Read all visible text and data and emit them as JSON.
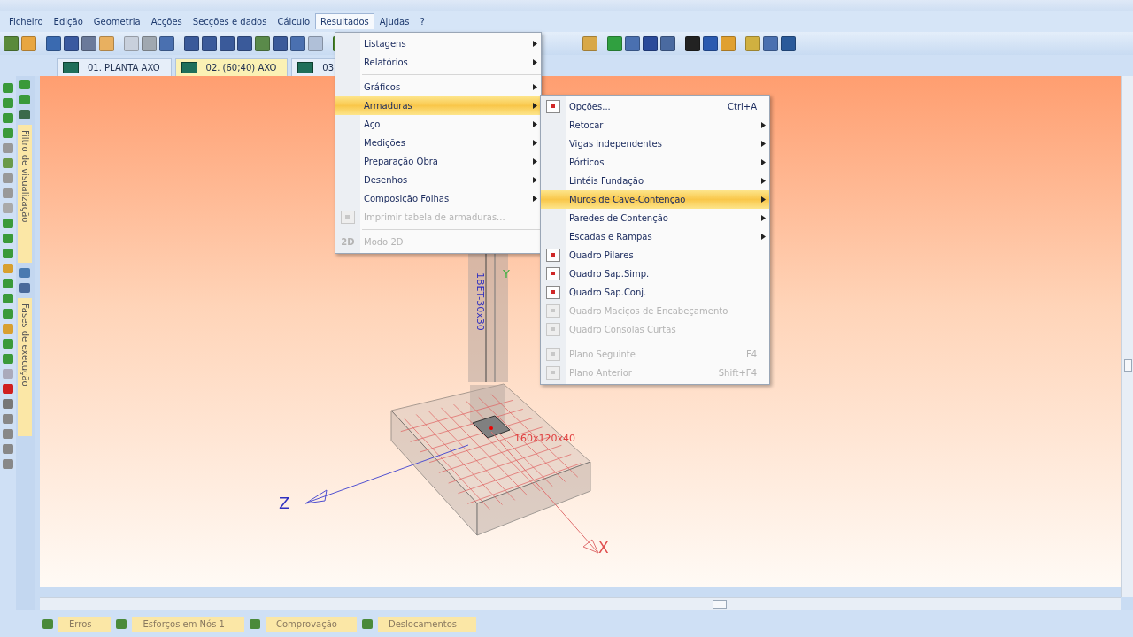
{
  "menu_bar": [
    {
      "label": "Ficheiro",
      "selected": false
    },
    {
      "label": "Edição",
      "selected": false
    },
    {
      "label": "Geometria",
      "selected": false
    },
    {
      "label": "Acções",
      "selected": false
    },
    {
      "label": "Secções e dados",
      "selected": false
    },
    {
      "label": "Cálculo",
      "selected": false
    },
    {
      "label": "Resultados",
      "selected": true
    },
    {
      "label": "Ajudas",
      "selected": false
    },
    {
      "label": "?",
      "selected": false
    }
  ],
  "view_tabs": [
    {
      "label": "01. PLANTA   AXO",
      "selected": false
    },
    {
      "label": "02.  (60;40)  AXO",
      "selected": true
    },
    {
      "label": "03.",
      "selected": false
    }
  ],
  "side_panels": [
    {
      "label": "Filtro de visualização"
    },
    {
      "label": "Fases de execução"
    }
  ],
  "menu": [
    {
      "kind": "item",
      "label": "Listagens",
      "selected": false,
      "disabled": false,
      "submenu": true
    },
    {
      "kind": "item",
      "label": "Relatórios",
      "selected": false,
      "disabled": false,
      "submenu": true
    },
    {
      "kind": "separator"
    },
    {
      "kind": "item",
      "label": "Gráficos",
      "selected": false,
      "disabled": false,
      "submenu": true
    },
    {
      "kind": "item",
      "label": "Armaduras",
      "selected": true,
      "disabled": false,
      "submenu": true
    },
    {
      "kind": "item",
      "label": "Aço",
      "selected": false,
      "disabled": false,
      "submenu": true
    },
    {
      "kind": "item",
      "label": "Medições",
      "selected": false,
      "disabled": false,
      "submenu": true
    },
    {
      "kind": "item",
      "label": "Preparação Obra",
      "selected": false,
      "disabled": false,
      "submenu": true
    },
    {
      "kind": "item",
      "label": "Desenhos",
      "selected": false,
      "disabled": false,
      "submenu": true
    },
    {
      "kind": "item",
      "label": "Composição Folhas",
      "selected": false,
      "disabled": false,
      "submenu": true
    },
    {
      "kind": "item",
      "label": "Imprimir tabela de armaduras...",
      "selected": false,
      "disabled": true,
      "submenu": false,
      "icon": true
    },
    {
      "kind": "separator"
    },
    {
      "kind": "item",
      "label": "Modo 2D",
      "selected": false,
      "disabled": true,
      "submenu": false,
      "icon_text": "2D"
    }
  ],
  "submenu": [
    {
      "kind": "item",
      "label": "Opções...",
      "selected": false,
      "disabled": false,
      "submenu": false,
      "shortcut": "Ctrl+A",
      "icon": true
    },
    {
      "kind": "item",
      "label": "Retocar",
      "selected": false,
      "disabled": false,
      "submenu": true
    },
    {
      "kind": "item",
      "label": "Vigas independentes",
      "selected": false,
      "disabled": false,
      "submenu": true
    },
    {
      "kind": "item",
      "label": "Pórticos",
      "selected": false,
      "disabled": false,
      "submenu": true
    },
    {
      "kind": "item",
      "label": "Lintéis Fundação",
      "selected": false,
      "disabled": false,
      "submenu": true
    },
    {
      "kind": "item",
      "label": "Muros de Cave-Contenção",
      "selected": true,
      "disabled": false,
      "submenu": true
    },
    {
      "kind": "item",
      "label": "Paredes de Contenção",
      "selected": false,
      "disabled": false,
      "submenu": true
    },
    {
      "kind": "item",
      "label": "Escadas e Rampas",
      "selected": false,
      "disabled": false,
      "submenu": true
    },
    {
      "kind": "item",
      "label": "Quadro Pilares",
      "selected": false,
      "disabled": false,
      "submenu": false,
      "icon": true
    },
    {
      "kind": "item",
      "label": "Quadro Sap.Simp.",
      "selected": false,
      "disabled": false,
      "submenu": false,
      "icon": true
    },
    {
      "kind": "item",
      "label": "Quadro Sap.Conj.",
      "selected": false,
      "disabled": false,
      "submenu": false,
      "icon": true
    },
    {
      "kind": "item",
      "label": "Quadro Maciços de Encabeçamento",
      "selected": false,
      "disabled": true,
      "submenu": false,
      "icon": true
    },
    {
      "kind": "item",
      "label": "Quadro Consolas Curtas",
      "selected": false,
      "disabled": true,
      "submenu": false,
      "icon": true
    },
    {
      "kind": "separator"
    },
    {
      "kind": "item",
      "label": "Plano Seguinte",
      "selected": false,
      "disabled": true,
      "submenu": false,
      "shortcut": "F4",
      "icon": true
    },
    {
      "kind": "item",
      "label": "Plano Anterior",
      "selected": false,
      "disabled": true,
      "submenu": false,
      "shortcut": "Shift+F4",
      "icon": true
    }
  ],
  "viewport": {
    "column_label": "1BET-30x30",
    "footing_label": "160x120x40",
    "axes": [
      "Z",
      "X",
      "Y"
    ]
  },
  "bottom_tabs": [
    {
      "label": "Erros"
    },
    {
      "label": "Esforços em Nós 1"
    },
    {
      "label": "Comprovação"
    },
    {
      "label": "Deslocamentos"
    }
  ]
}
